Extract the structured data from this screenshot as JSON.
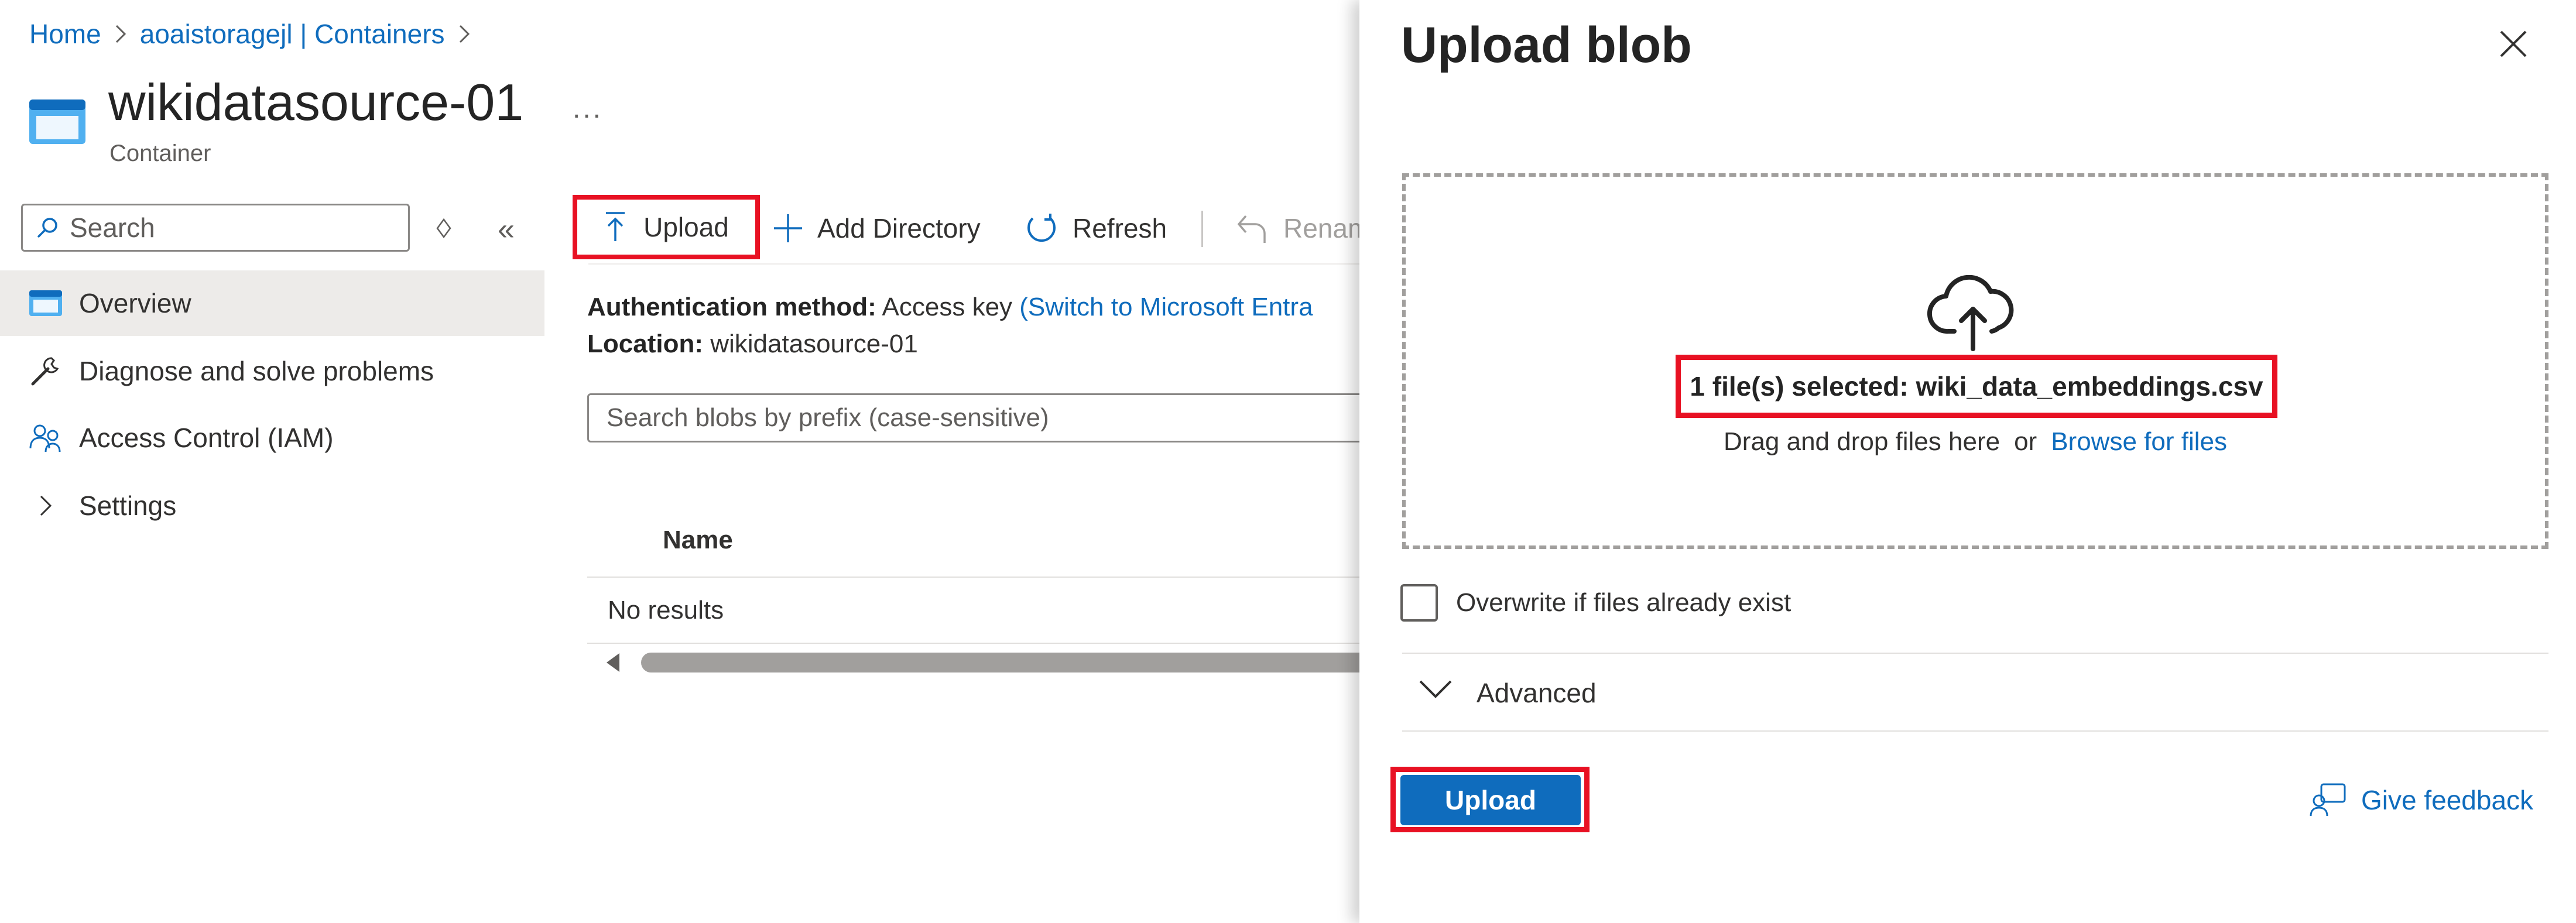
{
  "breadcrumb": {
    "home": "Home",
    "containers": "aoaistoragejl | Containers"
  },
  "header": {
    "title": "wikidatasource-01",
    "subtitle": "Container",
    "more": "..."
  },
  "nav": {
    "search_placeholder": "Search",
    "items": [
      {
        "label": "Overview",
        "icon": "container-icon",
        "selected": true
      },
      {
        "label": "Diagnose and solve problems",
        "icon": "wrench-icon"
      },
      {
        "label": "Access Control (IAM)",
        "icon": "people-icon"
      },
      {
        "label": "Settings",
        "icon": "chevron-right-icon"
      }
    ]
  },
  "toolbar": {
    "upload": "Upload",
    "add_directory": "Add Directory",
    "refresh": "Refresh",
    "rename": "Renam"
  },
  "info": {
    "auth_label": "Authentication method:",
    "auth_value": "Access key",
    "auth_link": "(Switch to Microsoft Entra",
    "location_label": "Location:",
    "location_value": "wikidatasource-01"
  },
  "blobs": {
    "search_placeholder": "Search blobs by prefix (case-sensitive)",
    "column_name": "Name",
    "empty": "No results"
  },
  "panel": {
    "title": "Upload blob",
    "selected_file": "1 file(s) selected: wiki_data_embeddings.csv",
    "drag_text": "Drag and drop files here",
    "or": "or",
    "browse": "Browse for files",
    "overwrite_label": "Overwrite if files already exist",
    "overwrite_checked": false,
    "advanced": "Advanced",
    "upload_button": "Upload",
    "feedback": "Give feedback"
  },
  "colors": {
    "accent": "#0f6cbd",
    "highlight": "#e81123",
    "selected_nav": "#edebe9"
  }
}
